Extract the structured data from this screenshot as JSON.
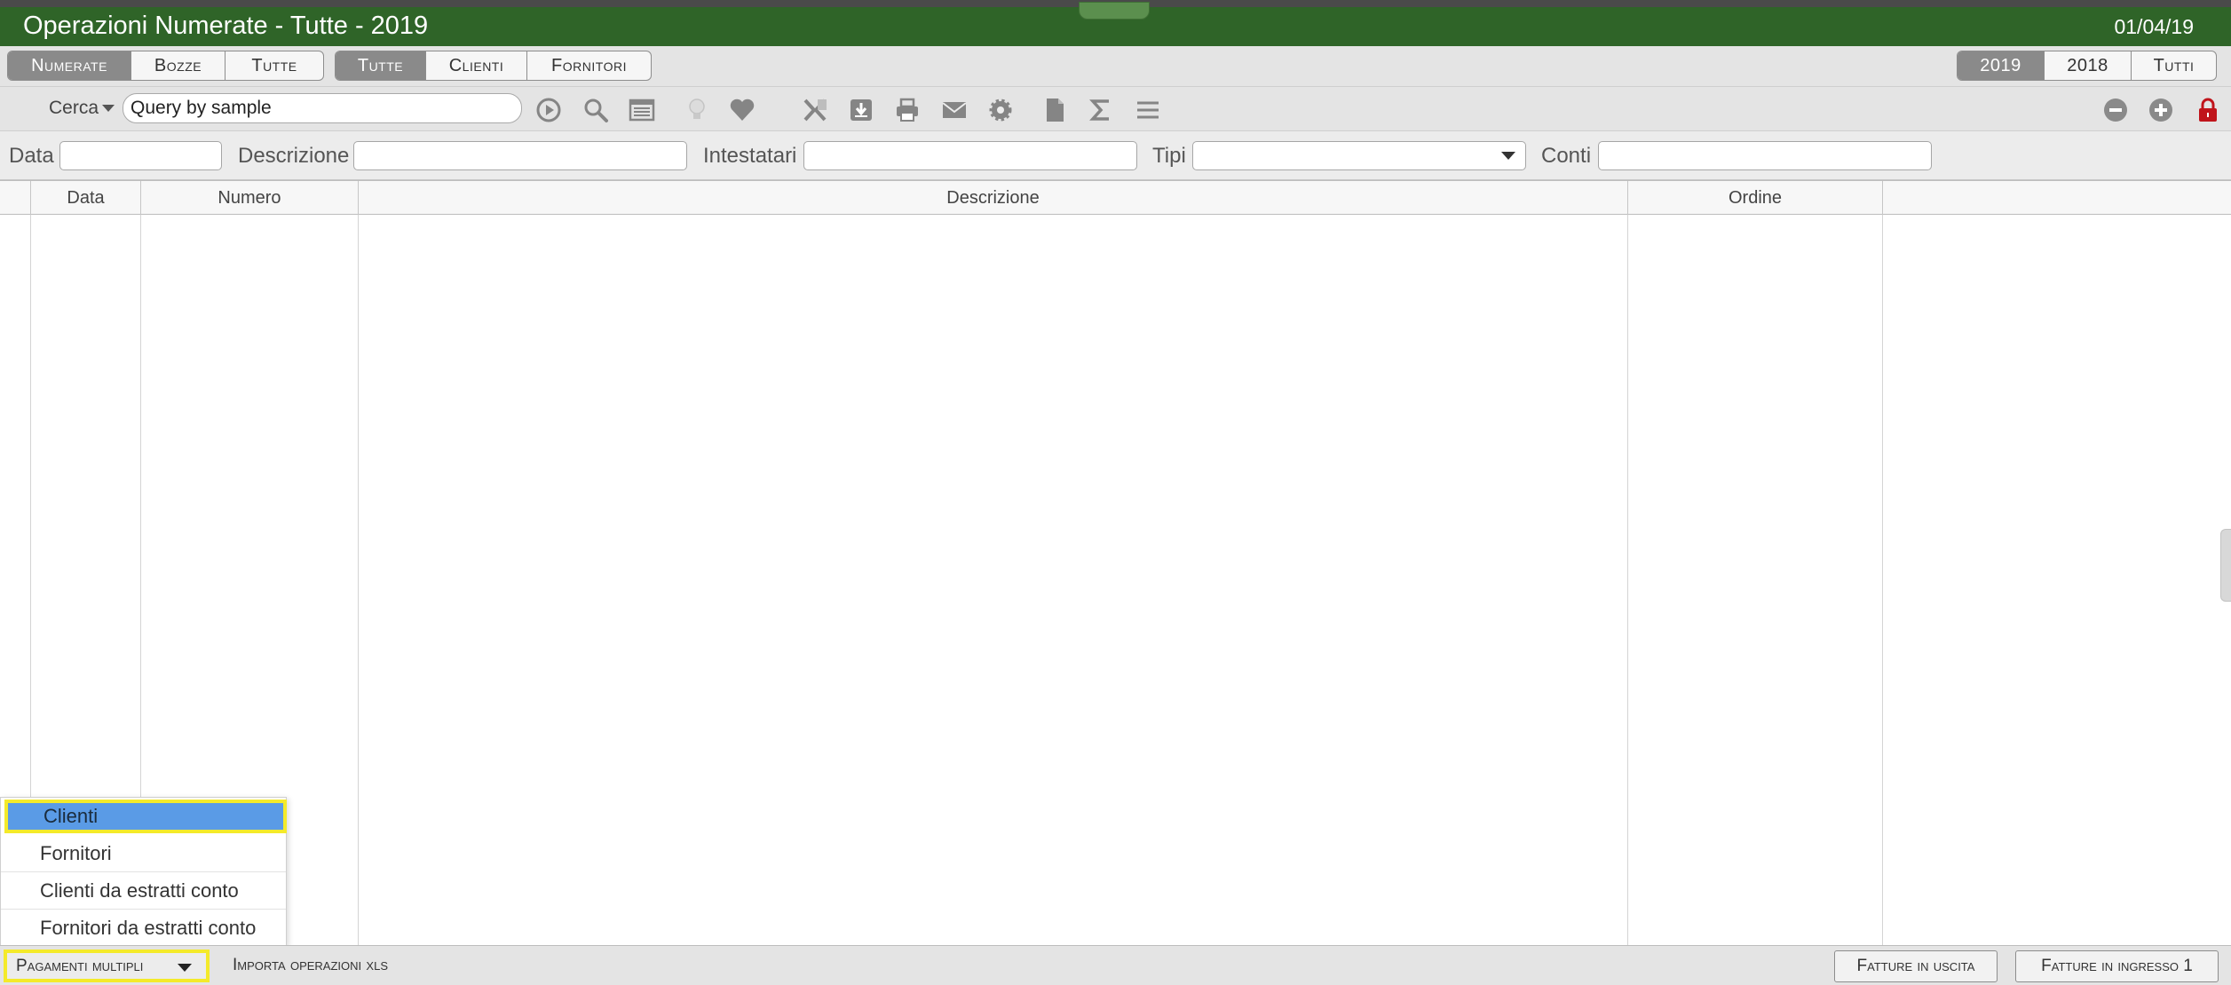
{
  "window": {
    "title": "Operazioni Numerate - Tutte - 2019",
    "date": "01/04/19"
  },
  "filters": {
    "status": [
      {
        "label": "Numerate",
        "active": true
      },
      {
        "label": "Bozze",
        "active": false
      },
      {
        "label": "Tutte",
        "active": false
      }
    ],
    "party": [
      {
        "label": "Tutte",
        "active": true
      },
      {
        "label": "Clienti",
        "active": false
      },
      {
        "label": "Fornitori",
        "active": false
      }
    ],
    "years": [
      {
        "label": "2019",
        "active": true
      },
      {
        "label": "2018",
        "active": false
      },
      {
        "label": "Tutti",
        "active": false
      }
    ]
  },
  "toolbar": {
    "search_label": "Cerca",
    "query_value": "Query by sample",
    "icons": [
      "play-icon",
      "magnifier-icon",
      "list-view-icon",
      "lightbulb-icon",
      "heart-icon",
      "excel-icon",
      "download-icon",
      "print-icon",
      "mail-icon",
      "gear-icon",
      "document-icon",
      "sigma-icon",
      "menu-icon",
      "minus-circle-icon",
      "plus-circle-icon",
      "lock-icon"
    ]
  },
  "search_fields": {
    "data_label": "Data",
    "descrizione_label": "Descrizione",
    "intestatari_label": "Intestatari",
    "tipi_label": "Tipi",
    "conti_label": "Conti"
  },
  "grid": {
    "columns": [
      "Data",
      "Numero",
      "Descrizione",
      "Ordine"
    ],
    "rows": []
  },
  "dropdown": {
    "items": [
      "Clienti",
      "Fornitori",
      "Clienti da estratti conto",
      "Fornitori da estratti conto"
    ],
    "selected_index": 0
  },
  "bottom": {
    "pagamenti_label": "Pagamenti multipli",
    "importa_label": "Importa operazioni xls",
    "fatture_uscita_label": "Fatture in uscita",
    "fatture_ingresso_label": "Fatture in ingresso 1"
  },
  "colors": {
    "titlebar": "#2f6428",
    "highlight": "#f4ea2a",
    "selection": "#5a9be6",
    "lock": "#c0141b"
  }
}
